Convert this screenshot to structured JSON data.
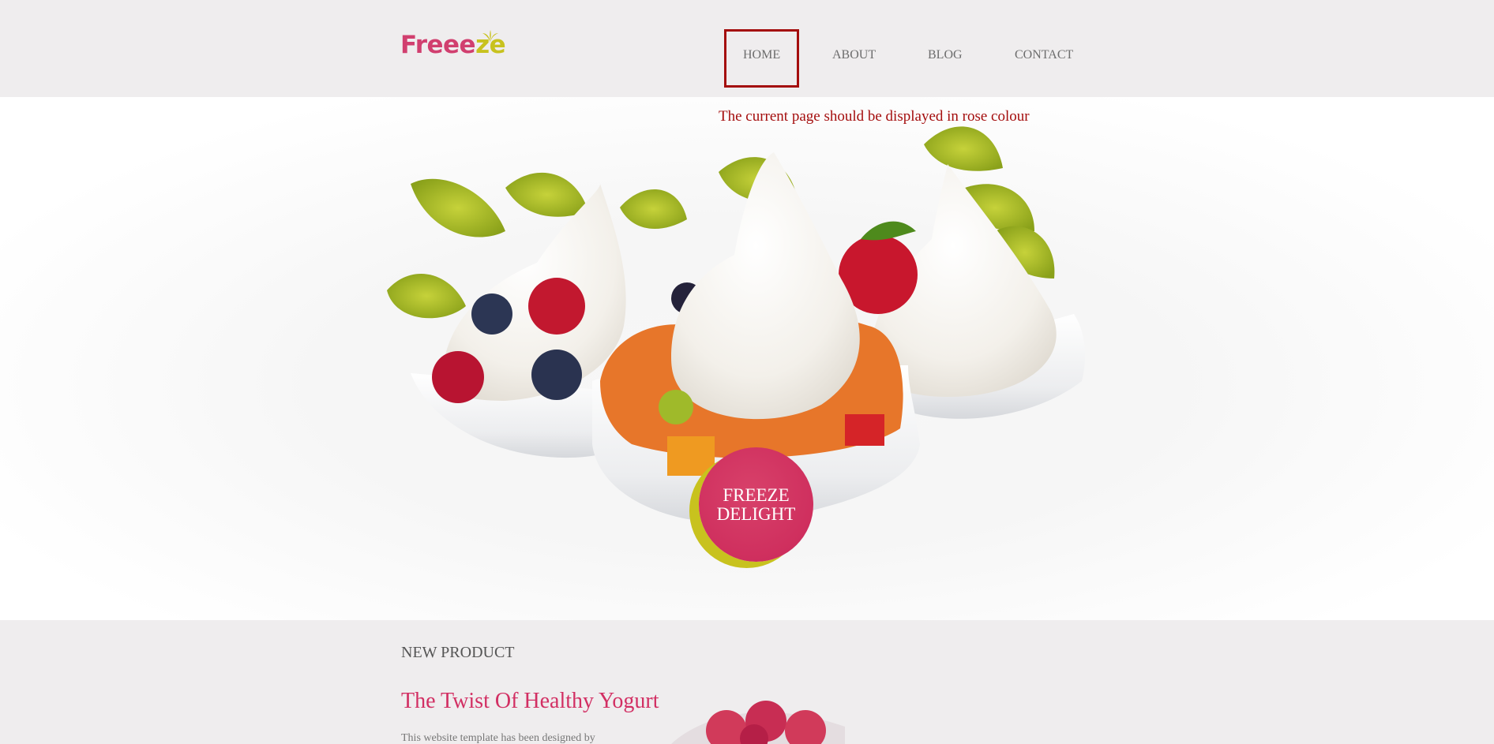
{
  "header": {
    "logo_text": "Freeeze",
    "logo_colors": {
      "pink": "#d13f6f",
      "lime": "#c8c21e"
    },
    "nav": [
      {
        "label": "HOME",
        "current": true
      },
      {
        "label": "ABOUT"
      },
      {
        "label": "BLOG"
      },
      {
        "label": "CONTACT"
      }
    ]
  },
  "annotation": {
    "text": "The current page should be displayed in rose colour",
    "color": "#a40d0d"
  },
  "hero": {
    "badge_line1": "FREEZE",
    "badge_line2": "DELIGHT",
    "badge_color": "#cf2f5e",
    "badge_accent_color": "#c8c21e"
  },
  "new_product": {
    "label": "NEW PRODUCT",
    "title": "The Twist Of Healthy Yogurt",
    "text": "This website template has been designed by",
    "title_color": "#d22f63"
  }
}
